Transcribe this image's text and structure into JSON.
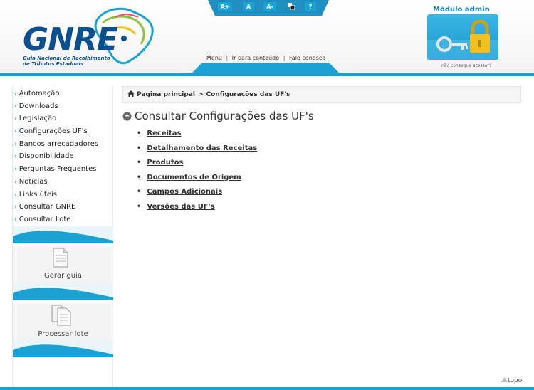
{
  "header": {
    "logo_text": "GNRE",
    "logo_subtitle_line1": "Guia Nacional de Recolhimento",
    "logo_subtitle_line2": "de Tributos Estaduais",
    "accessibility": [
      "A+",
      "A",
      "A-",
      "",
      "?"
    ],
    "top_links": [
      "Menu",
      "Ir para conteúdo",
      "Fale conosco"
    ],
    "admin": {
      "title": "Módulo admin",
      "help_link": "não consegue acessar?"
    }
  },
  "sidebar": {
    "items": [
      "Automação",
      "Downloads",
      "Legislação",
      "Configurações UF's",
      "Bancos arrecadadores",
      "Disponibilidade",
      "Perguntas Frequentes",
      "Notícias",
      "Links úteis",
      "Consultar GNRE",
      "Consultar Lote"
    ],
    "panels": {
      "gerar": "Gerar guia",
      "processar": "Processar lote"
    }
  },
  "breadcrumb": {
    "home": "Pagina principal",
    "separator": ">",
    "current": "Configurações das UF's"
  },
  "main": {
    "title": "Consultar Configurações das UF's",
    "links": [
      "Receitas",
      "Detalhamento das Receitas",
      "Produtos",
      "Documentos de Origem",
      "Campos Adicionais",
      "Versões das UF's"
    ]
  },
  "footer": {
    "topo": "topo"
  },
  "colors": {
    "accent": "#1aa2d4",
    "brand": "#0b4f8f"
  }
}
